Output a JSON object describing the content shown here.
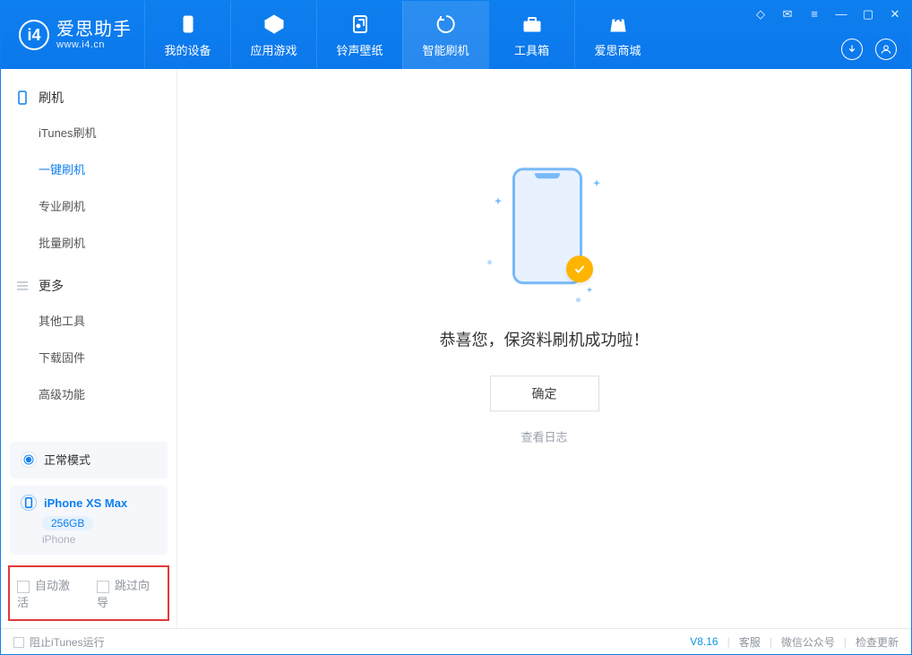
{
  "logo": {
    "cn": "爱思助手",
    "en": "www.i4.cn",
    "mark": "i4"
  },
  "nav": {
    "items": [
      {
        "label": "我的设备"
      },
      {
        "label": "应用游戏"
      },
      {
        "label": "铃声壁纸"
      },
      {
        "label": "智能刷机"
      },
      {
        "label": "工具箱"
      },
      {
        "label": "爱思商城"
      }
    ]
  },
  "sidebar": {
    "group_flash": {
      "title": "刷机",
      "items": [
        "iTunes刷机",
        "一键刷机",
        "专业刷机",
        "批量刷机"
      ]
    },
    "group_more": {
      "title": "更多",
      "items": [
        "其他工具",
        "下载固件",
        "高级功能"
      ]
    }
  },
  "mode_card": {
    "label": "正常模式"
  },
  "device_card": {
    "name": "iPhone XS Max",
    "storage": "256GB",
    "type": "iPhone"
  },
  "bottom_checks": {
    "auto_activate": "自动激活",
    "skip_guide": "跳过向导"
  },
  "main": {
    "success_message": "恭喜您，保资料刷机成功啦！",
    "ok_button": "确定",
    "view_log": "查看日志"
  },
  "statusbar": {
    "block_itunes": "阻止iTunes运行",
    "version": "V8.16",
    "links": [
      "客服",
      "微信公众号",
      "检查更新"
    ]
  }
}
